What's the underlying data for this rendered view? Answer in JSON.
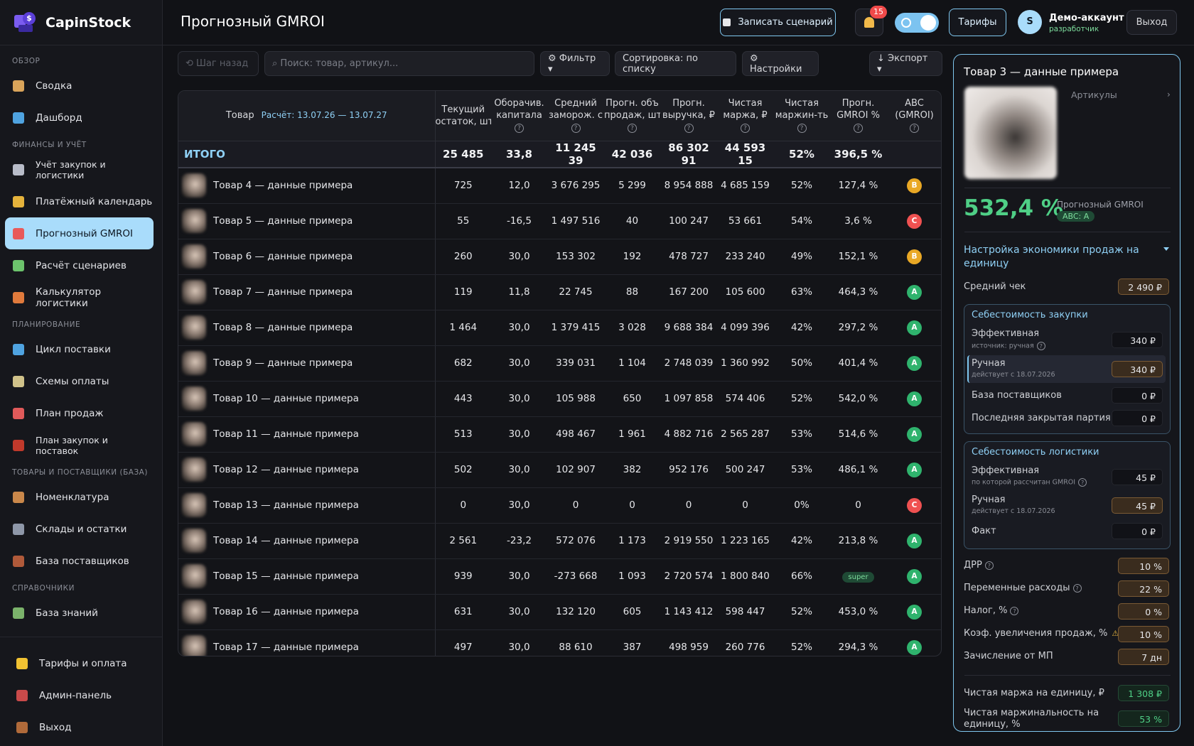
{
  "app": {
    "name": "CapinStock"
  },
  "sidebar": {
    "sections": [
      {
        "title": "ОБЗОР",
        "items": [
          {
            "label": "Сводка"
          },
          {
            "label": "Дашборд"
          }
        ]
      },
      {
        "title": "ФИНАНСЫ И УЧЁТ",
        "items": [
          {
            "label": "Учёт закупок и логистики"
          },
          {
            "label": "Платёжный календарь"
          },
          {
            "label": "Прогнозный GMROI"
          },
          {
            "label": "Расчёт сценариев"
          },
          {
            "label": "Калькулятор логистики"
          }
        ]
      },
      {
        "title": "ПЛАНИРОВАНИЕ",
        "items": [
          {
            "label": "Цикл поставки"
          },
          {
            "label": "Схемы оплаты"
          },
          {
            "label": "План продаж"
          },
          {
            "label": "План закупок и поставок"
          }
        ]
      },
      {
        "title": "ТОВАРЫ И ПОСТАВЩИКИ (БАЗА)",
        "items": [
          {
            "label": "Номенклатура"
          },
          {
            "label": "Склады и остатки"
          },
          {
            "label": "База поставщиков"
          }
        ]
      },
      {
        "title": "СПРАВОЧНИКИ",
        "items": [
          {
            "label": "База знаний"
          }
        ]
      }
    ],
    "bottom": [
      {
        "label": "Тарифы и оплата"
      },
      {
        "label": "Админ-панель"
      },
      {
        "label": "Выход"
      }
    ]
  },
  "header": {
    "title": "Прогнозный GMROI",
    "record_label": "Записать сценарий",
    "notifications": "15",
    "tariffs_label": "Тарифы",
    "avatar_letter": "S",
    "account_name": "Демо-аккаунт",
    "account_role": "разработчик",
    "logout_label": "Выход"
  },
  "toolbar": {
    "back_label": "⟲ Шаг назад",
    "search_placeholder": "⌕ Поиск: товар, артикул...",
    "filter_label": "⚙ Фильтр ▾",
    "sort_label": "Сортировка: по списку",
    "settings_label": "⚙ Настройки",
    "export_label": "↓ Экспорт ▾"
  },
  "table": {
    "product_header": "Товар",
    "period": "Расчёт: 13.07.26 — 13.07.27",
    "columns": [
      {
        "l1": "Текущий",
        "l2": "остаток, шт"
      },
      {
        "l1": "Оборачив.",
        "l2": "капитала"
      },
      {
        "l1": "Средний",
        "l2": "заморож. с"
      },
      {
        "l1": "Прогн. объ",
        "l2": "продаж, шт"
      },
      {
        "l1": "Прогн.",
        "l2": "выручка, ₽"
      },
      {
        "l1": "Чистая",
        "l2": "маржа, ₽"
      },
      {
        "l1": "Чистая",
        "l2": "маржин-ть"
      },
      {
        "l1": "Прогн.",
        "l2": "GMROI %"
      },
      {
        "l1": "ABC",
        "l2": "(GMROI)"
      }
    ],
    "total": {
      "label": "ИТОГО",
      "stock": "25 485",
      "turnover": "33,8",
      "frozen": "11 245 39",
      "volume": "42 036",
      "revenue": "86 302 91",
      "margin": "44 593 15",
      "margin_pct": "52%",
      "gmroi": "396,5 %"
    },
    "rows": [
      {
        "name": "Товар 4 — данные примера",
        "stock": "725",
        "turnover": "12,0",
        "frozen": "3 676 295",
        "volume": "5 299",
        "revenue": "8 954 888",
        "margin": "4 685 159",
        "margin_pct": "52%",
        "gmroi": "127,4 %",
        "gmroi_color": "green",
        "abc": "B"
      },
      {
        "name": "Товар 5 — данные примера",
        "stock": "55",
        "turnover": "-16,5",
        "frozen": "1 497 516",
        "volume": "40",
        "revenue": "100 247",
        "margin": "53 661",
        "margin_pct": "54%",
        "gmroi": "3,6 %",
        "gmroi_color": "orange",
        "abc": "C"
      },
      {
        "name": "Товар 6 — данные примера",
        "stock": "260",
        "turnover": "30,0",
        "frozen": "153 302",
        "volume": "192",
        "revenue": "478 727",
        "margin": "233 240",
        "margin_pct": "49%",
        "gmroi": "152,1 %",
        "gmroi_color": "green",
        "abc": "B"
      },
      {
        "name": "Товар 7 — данные примера",
        "stock": "119",
        "turnover": "11,8",
        "frozen": "22 745",
        "volume": "88",
        "revenue": "167 200",
        "margin": "105 600",
        "margin_pct": "63%",
        "gmroi": "464,3 %",
        "gmroi_color": "green",
        "abc": "A"
      },
      {
        "name": "Товар 8 — данные примера",
        "stock": "1 464",
        "turnover": "30,0",
        "frozen": "1 379 415",
        "volume": "3 028",
        "revenue": "9 688 384",
        "margin": "4 099 396",
        "margin_pct": "42%",
        "gmroi": "297,2 %",
        "gmroi_color": "green",
        "abc": "A"
      },
      {
        "name": "Товар 9 — данные примера",
        "stock": "682",
        "turnover": "30,0",
        "frozen": "339 031",
        "volume": "1 104",
        "revenue": "2 748 039",
        "margin": "1 360 992",
        "margin_pct": "50%",
        "gmroi": "401,4 %",
        "gmroi_color": "green",
        "abc": "A"
      },
      {
        "name": "Товар 10 — данные примера",
        "stock": "443",
        "turnover": "30,0",
        "frozen": "105 988",
        "volume": "650",
        "revenue": "1 097 858",
        "margin": "574 406",
        "margin_pct": "52%",
        "gmroi": "542,0 %",
        "gmroi_color": "green",
        "abc": "A"
      },
      {
        "name": "Товар 11 — данные примера",
        "stock": "513",
        "turnover": "30,0",
        "frozen": "498 467",
        "volume": "1 961",
        "revenue": "4 882 716",
        "margin": "2 565 287",
        "margin_pct": "53%",
        "gmroi": "514,6 %",
        "gmroi_color": "green",
        "abc": "A"
      },
      {
        "name": "Товар 12 — данные примера",
        "stock": "502",
        "turnover": "30,0",
        "frozen": "102 907",
        "volume": "382",
        "revenue": "952 176",
        "margin": "500 247",
        "margin_pct": "53%",
        "gmroi": "486,1 %",
        "gmroi_color": "green",
        "abc": "A"
      },
      {
        "name": "Товар 13 — данные примера",
        "stock": "0",
        "turnover": "30,0",
        "frozen": "0",
        "volume": "0",
        "revenue": "0",
        "margin": "0",
        "margin_pct": "0%",
        "gmroi": "0",
        "gmroi_color": "grey",
        "abc": "C"
      },
      {
        "name": "Товар 14 — данные примера",
        "stock": "2 561",
        "turnover": "-23,2",
        "frozen": "572 076",
        "volume": "1 173",
        "revenue": "2 919 550",
        "margin": "1 223 165",
        "margin_pct": "42%",
        "gmroi": "213,8 %",
        "gmroi_color": "green",
        "abc": "A"
      },
      {
        "name": "Товар 15 — данные примера",
        "stock": "939",
        "turnover": "30,0",
        "frozen": "-273 668",
        "volume": "1 093",
        "revenue": "2 720 574",
        "margin": "1 800 840",
        "margin_pct": "66%",
        "gmroi": "super",
        "gmroi_color": "pill",
        "abc": "A"
      },
      {
        "name": "Товар 16 — данные примера",
        "stock": "631",
        "turnover": "30,0",
        "frozen": "132 120",
        "volume": "605",
        "revenue": "1 143 412",
        "margin": "598 447",
        "margin_pct": "52%",
        "gmroi": "453,0 %",
        "gmroi_color": "green",
        "abc": "A"
      },
      {
        "name": "Товар 17 — данные примера",
        "stock": "497",
        "turnover": "30,0",
        "frozen": "88 610",
        "volume": "387",
        "revenue": "498 959",
        "margin": "260 776",
        "margin_pct": "52%",
        "gmroi": "294,3 %",
        "gmroi_color": "green",
        "abc": "A"
      }
    ]
  },
  "panel": {
    "title": "Товар 3 — данные примера",
    "articles_label": "Артикулы",
    "articles_chevron": "›",
    "gmroi_value": "532,4 %",
    "gmroi_label": "Прогнозный GMROI",
    "abc_label": "ABC: A",
    "section_title": "Настройка экономики продаж на единицу",
    "avg_check_label": "Средний чек",
    "avg_check_value": "2 490 ₽",
    "purchase": {
      "title": "Себестоимость закупки",
      "effective_label": "Эффективная",
      "effective_sub": "источник: ручная",
      "effective_value": "340 ₽",
      "manual_label": "Ручная",
      "manual_sub": "действует с 18.07.2026",
      "manual_value": "340 ₽",
      "suppliers_label": "База поставщиков",
      "suppliers_value": "0 ₽",
      "last_batch_label": "Последняя закрытая партия",
      "last_batch_value": "0 ₽"
    },
    "logistics": {
      "title": "Себестоимость логистики",
      "effective_label": "Эффективная",
      "effective_sub": "по которой рассчитан GMROI",
      "effective_value": "45 ₽",
      "manual_label": "Ручная",
      "manual_sub": "действует с 18.07.2026",
      "manual_value": "45 ₽",
      "fact_label": "Факт",
      "fact_value": "0 ₽"
    },
    "drr_label": "ДРР",
    "drr_value": "10 %",
    "variable_label": "Переменные расходы",
    "variable_value": "22 %",
    "tax_label": "Налог, %",
    "tax_value": "0 %",
    "growth_label": "Коэф. увеличения продаж, %",
    "growth_value": "10 %",
    "payout_label": "Зачисление от МП",
    "payout_value": "7 дн",
    "unit_margin_label": "Чистая маржа на единицу, ₽",
    "unit_margin_value": "1 308 ₽",
    "unit_margin_pct_label": "Чистая маржинальность на единицу, %",
    "unit_margin_pct_value": "53 %"
  },
  "colors": {
    "accent": "#a9dcfb",
    "positive": "#4fcf86",
    "warning": "#e5b33c",
    "negative": "#ef5151",
    "panel_border": "#7fc7ef"
  }
}
